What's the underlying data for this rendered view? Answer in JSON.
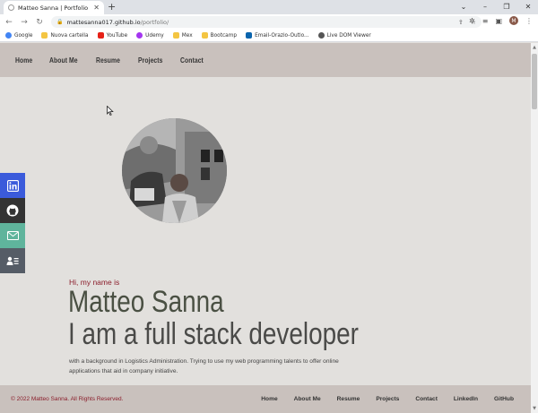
{
  "browser": {
    "tab_title": "Matteo Sanna | Portfolio",
    "url_host": "mattesanna017.github.io",
    "url_path": "/portfolio/",
    "profile_initial": "M",
    "bookmarks": [
      {
        "label": "Google",
        "color": "#4285f4"
      },
      {
        "label": "Nuova cartella",
        "color": "#f4c542"
      },
      {
        "label": "YouTube",
        "color": "#e62117"
      },
      {
        "label": "Udemy",
        "color": "#a435f0"
      },
      {
        "label": "Mex",
        "color": "#f4c542"
      },
      {
        "label": "Bootcamp",
        "color": "#f4c542"
      },
      {
        "label": "Email-Orazio-Outlo...",
        "color": "#0a64ad"
      },
      {
        "label": "Live DOM Viewer",
        "color": "#555555"
      }
    ]
  },
  "site": {
    "nav": [
      "Home",
      "About Me",
      "Resume",
      "Projects",
      "Contact"
    ],
    "social": [
      {
        "name": "linkedin",
        "color": "#3b5bdb"
      },
      {
        "name": "github",
        "color": "#333333"
      },
      {
        "name": "email",
        "color": "#5fb49c"
      },
      {
        "name": "contact-card",
        "color": "#555c66"
      }
    ],
    "hero": {
      "greeting": "Hi, my name is",
      "name": "Matteo Sanna",
      "role": "I am a full stack developer",
      "bio": "with a background in Logistics Administration. Trying to use my web programming talents to offer online applications that aid in company initiative."
    },
    "footer": {
      "copyright": "© 2022 Matteo Sanna. All Rights Reserved.",
      "links": [
        "Home",
        "About Me",
        "Resume",
        "Projects",
        "Contact",
        "LinkedIn",
        "GitHub"
      ]
    }
  },
  "colors": {
    "accent": "#8b1d2b",
    "nav_bg": "#c9c1bd",
    "page_bg": "#e2e0dd",
    "name_color": "#4a5043"
  }
}
